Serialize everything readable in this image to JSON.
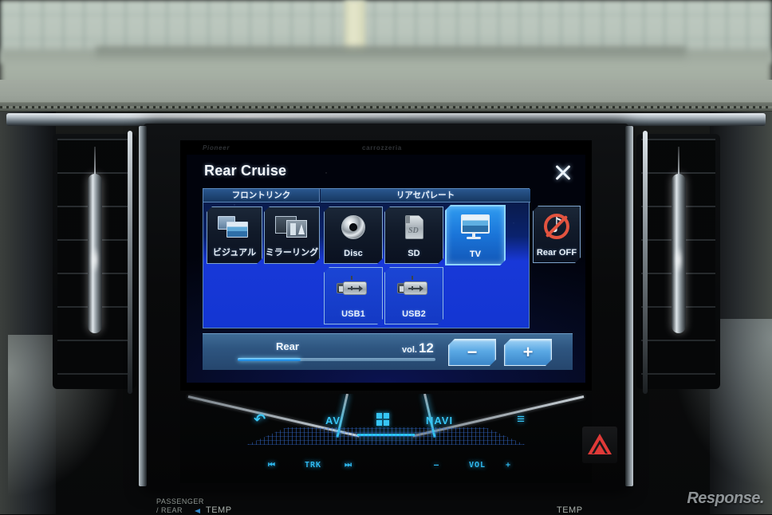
{
  "device": {
    "brand_left": "Pioneer",
    "brand_right": "carrozzeria"
  },
  "screen": {
    "title": "Rear Cruise",
    "close_label": "×",
    "groups": [
      {
        "id": "front-link",
        "header": "フロントリンク"
      },
      {
        "id": "rear-separate",
        "header": "リアセパレート"
      }
    ],
    "buttons": {
      "visual": {
        "label": "ビジュアル",
        "icon": "visual-icon",
        "selected": false
      },
      "mirroring": {
        "label": "ミラーリング",
        "icon": "mirroring-icon",
        "selected": false
      },
      "disc": {
        "label": "Disc",
        "icon": "disc-icon",
        "selected": false
      },
      "sd": {
        "label": "SD",
        "icon": "sd-card-icon",
        "selected": false
      },
      "tv": {
        "label": "TV",
        "icon": "tv-icon",
        "selected": true
      },
      "rear_off": {
        "label": "Rear OFF",
        "icon": "no-audio-icon",
        "selected": false
      },
      "usb1": {
        "label": "USB1",
        "icon": "usb-icon",
        "selected": false
      },
      "usb2": {
        "label": "USB2",
        "icon": "usb-icon",
        "selected": false
      }
    },
    "volume": {
      "zone_label": "Rear",
      "prefix": "vol.",
      "value": "12",
      "percent": 32,
      "minus_label": "−",
      "plus_label": "+"
    },
    "colors": {
      "accent_blue": "#1838d8",
      "selected_blue": "#2f9bf0",
      "glow_cyan": "#8fd6ff",
      "header_blue": "#2a5890"
    }
  },
  "hard_keys": {
    "back": "↶",
    "av": "AV",
    "home": "home-grid-icon",
    "navi": "NAVI",
    "menu": "≡",
    "prev_track": "⏮",
    "trk": "TRK",
    "next_track": "⏭",
    "vol_minus": "—",
    "vol": "VOL",
    "vol_plus": "+"
  },
  "dashboard": {
    "hazard": "hazard-triangle-icon",
    "passenger_rear": "PASSENGER",
    "passenger_rear2": "/ REAR",
    "temp_left": "TEMP",
    "temp_right": "TEMP"
  },
  "watermark": "Response."
}
